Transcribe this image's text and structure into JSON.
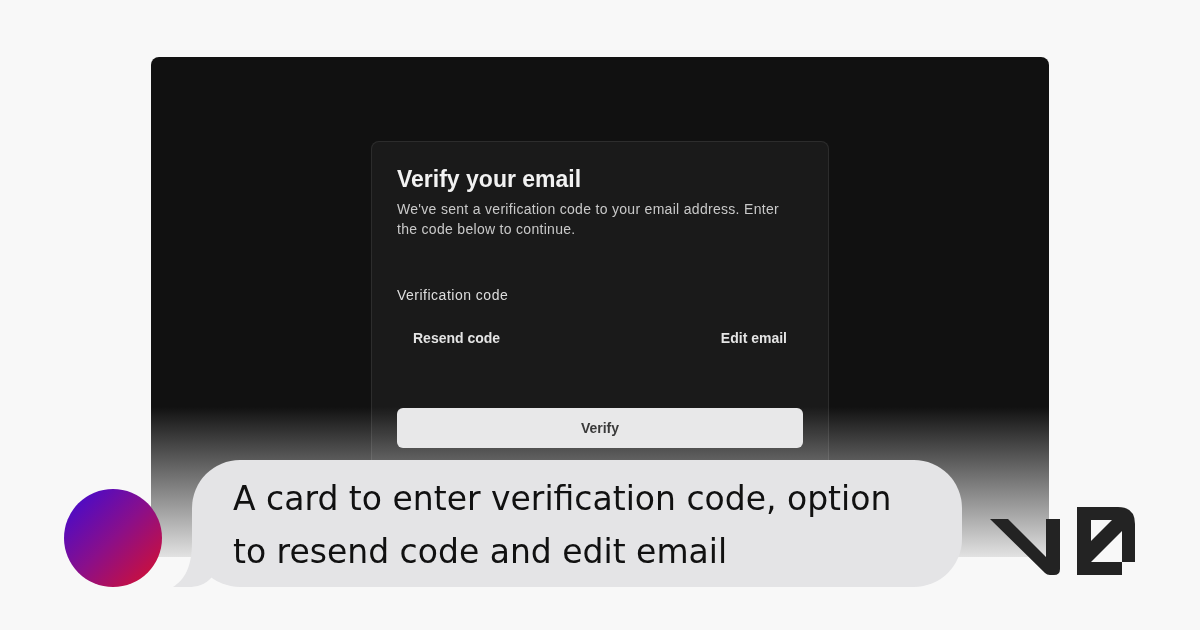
{
  "preview": {
    "card": {
      "title": "Verify your email",
      "description": "We've sent a verification code to your email address. Enter the code below to continue.",
      "field_label": "Verification code",
      "actions": [
        "Resend code",
        "Edit email"
      ],
      "submit_button": "Verify"
    }
  },
  "caption": {
    "text": "A card to enter verification code, option to resend code and edit email"
  }
}
